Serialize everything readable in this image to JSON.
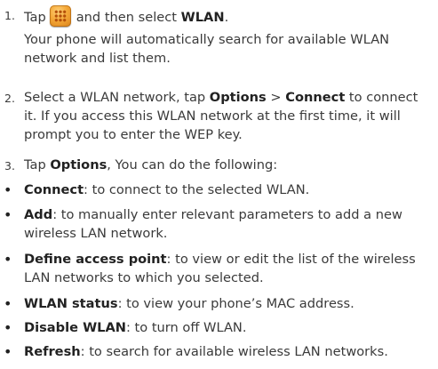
{
  "steps": [
    {
      "num": "1.",
      "pre": "Tap",
      "post": "and then select",
      "bold": "WLAN",
      "end": ".",
      "icon": "apps-grid-icon",
      "detail": "Your phone will automatically search for available WLAN network and list them."
    },
    {
      "num": "2.",
      "text_a": "Select a WLAN network, tap ",
      "bold_a": "Options",
      "text_b": " > ",
      "bold_b": "Connect",
      "text_c": " to connect it. If you access this WLAN network at the first time, it will prompt you to enter the WEP key."
    },
    {
      "num": "3.",
      "text_a": "Tap ",
      "bold_a": "Options",
      "text_b": ", You can do the following:"
    }
  ],
  "bullets": [
    {
      "term": "Connect",
      "desc": ": to connect to the selected WLAN."
    },
    {
      "term": "Add",
      "desc": ": to manually enter relevant parameters to add a new wireless LAN network."
    },
    {
      "term": "Define access point",
      "desc": ": to view or edit the list of the wireless LAN networks to which you selected."
    },
    {
      "term": "WLAN status",
      "desc": ": to view your phone’s MAC address."
    },
    {
      "term": "Disable WLAN",
      "desc": ": to turn off WLAN."
    },
    {
      "term": "Refresh",
      "desc": ": to search for available wireless LAN networks."
    }
  ],
  "bullet_glyph": "•"
}
